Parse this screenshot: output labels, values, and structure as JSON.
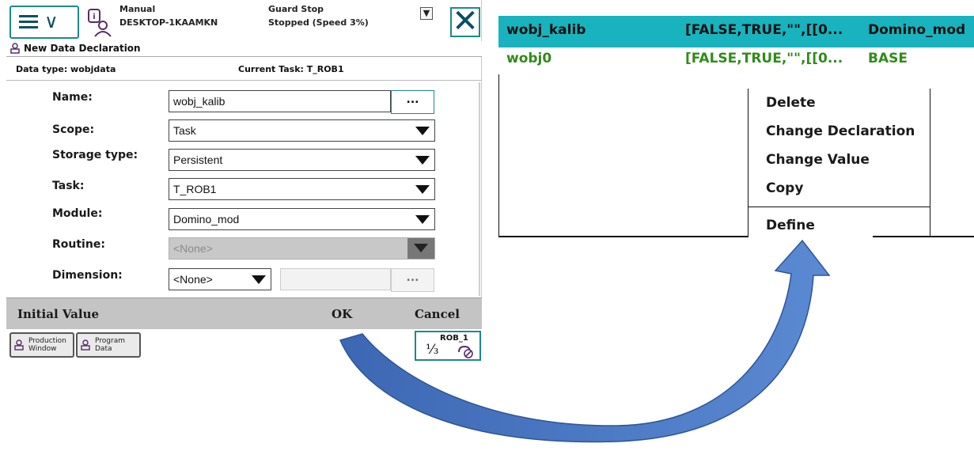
{
  "header": {
    "mode": "Manual",
    "host": "DESKTOP-1KAAMKN",
    "guard_status": "Guard Stop",
    "run_status": "Stopped (Speed 3%)"
  },
  "dialog": {
    "title": "New Data Declaration",
    "data_type": "Data type: wobjdata",
    "current_task": "Current Task:  T_ROB1",
    "fields": {
      "name": {
        "label": "Name:",
        "value": "wobj_kalib"
      },
      "scope": {
        "label": "Scope:",
        "value": "Task"
      },
      "storage_type": {
        "label": "Storage type:",
        "value": "Persistent"
      },
      "task": {
        "label": "Task:",
        "value": "T_ROB1"
      },
      "module": {
        "label": "Module:",
        "value": "Domino_mod"
      },
      "routine": {
        "label": "Routine:",
        "value": "<None>"
      },
      "dimension": {
        "label": "Dimension:",
        "value": "<None>"
      }
    },
    "dots": "...",
    "commands": {
      "initial_value": "Initial Value",
      "ok": "OK",
      "cancel": "Cancel"
    }
  },
  "taskbar": {
    "production_window": {
      "line1": "Production",
      "line2": "Window"
    },
    "program_data": {
      "line1": "Program",
      "line2": "Data"
    },
    "rob": {
      "name": "ROB_1",
      "fraction": "⅓"
    }
  },
  "data_list": {
    "rows": [
      {
        "name": "wobj_kalib",
        "value": "[FALSE,TRUE,\"\",[[0...",
        "module": "Domino_mod"
      },
      {
        "name": "wobj0",
        "value": "[FALSE,TRUE,\"\",[[0...",
        "module": "BASE"
      }
    ]
  },
  "context_menu": {
    "items": [
      "Delete",
      "Change Declaration",
      "Change Value",
      "Copy"
    ],
    "define": "Define"
  },
  "colors": {
    "accent": "#1c8a8a",
    "header_highlight": "#18b3be",
    "green_text": "#2f8c18",
    "arrow": "#4a78c0"
  }
}
